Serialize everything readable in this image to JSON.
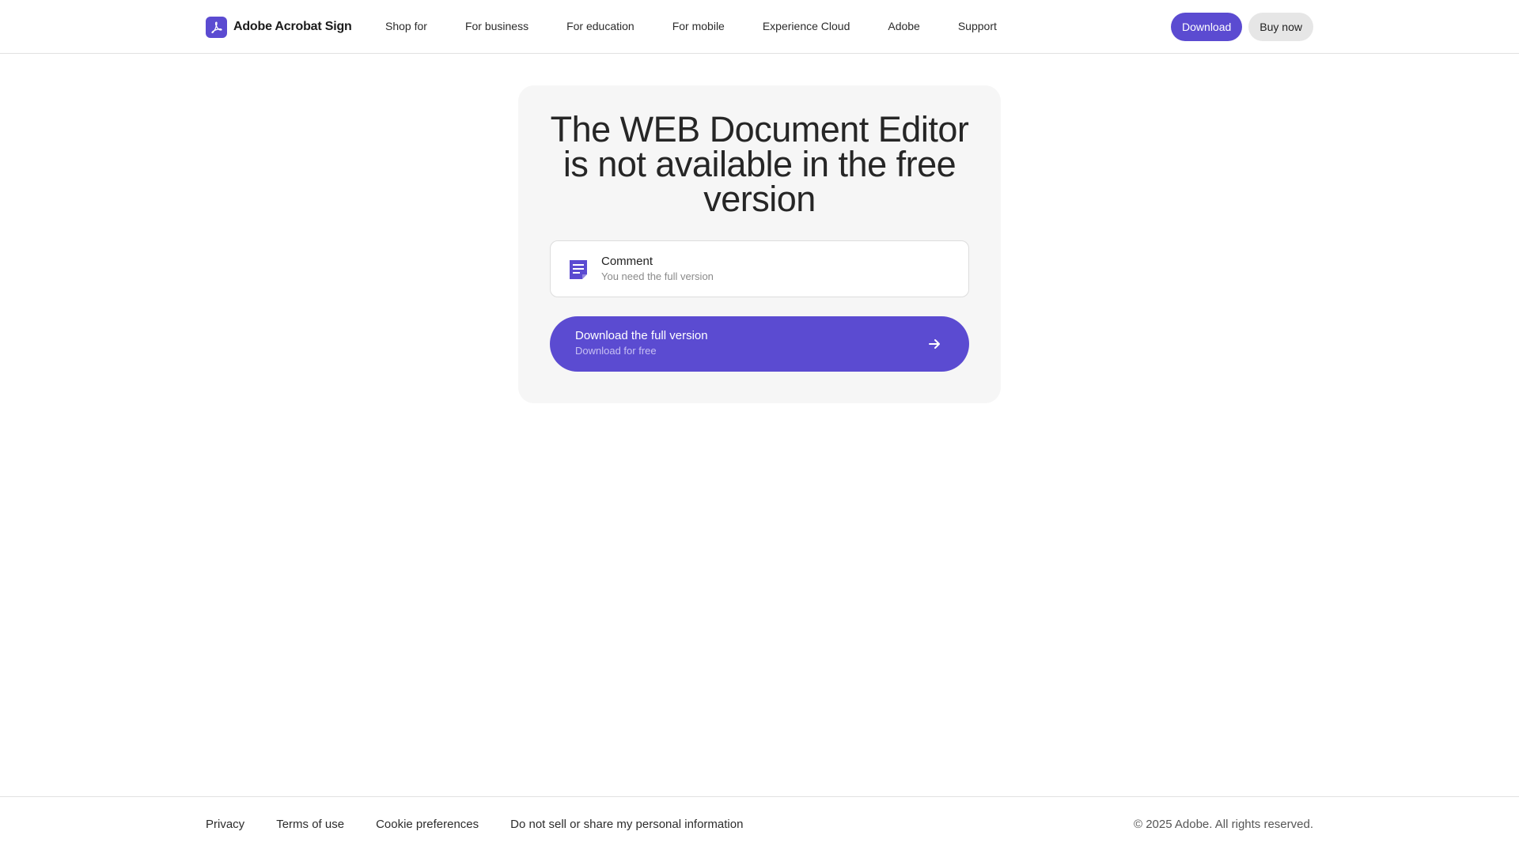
{
  "header": {
    "brand_name": "Adobe Acrobat Sign",
    "nav": [
      {
        "label": "Shop for"
      },
      {
        "label": "For business"
      },
      {
        "label": "For education"
      },
      {
        "label": "For mobile"
      },
      {
        "label": "Experience Cloud"
      },
      {
        "label": "Adobe"
      },
      {
        "label": "Support"
      }
    ],
    "download_label": "Download",
    "buy_label": "Buy now"
  },
  "main": {
    "headline": "The WEB Document Editor is not available in the free version",
    "feature": {
      "icon": "comment-icon",
      "title": "Comment",
      "subtitle": "You need the full version"
    },
    "cta": {
      "title": "Download the full version",
      "subtitle": "Download for free",
      "icon": "arrow-right-icon"
    }
  },
  "footer": {
    "links": [
      {
        "label": "Privacy"
      },
      {
        "label": "Terms of use"
      },
      {
        "label": "Cookie preferences"
      },
      {
        "label": "Do not sell or share my personal information"
      }
    ],
    "copyright": "© 2025 Adobe. All rights reserved."
  },
  "colors": {
    "accent": "#5b4bd1",
    "card_background": "#f6f6f6",
    "secondary_button": "#e6e6e6"
  }
}
